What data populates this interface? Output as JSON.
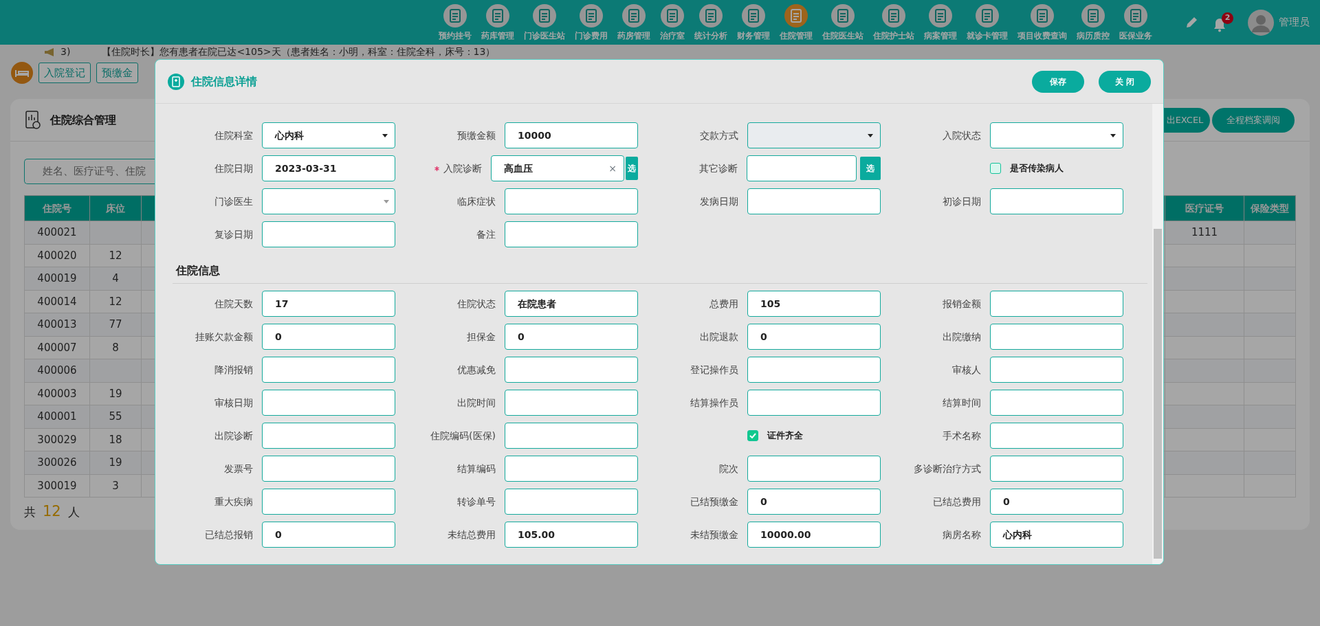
{
  "top_nav": {
    "items": [
      {
        "label": "预约挂号",
        "selected": false
      },
      {
        "label": "药库管理",
        "selected": false
      },
      {
        "label": "门诊医生站",
        "selected": false
      },
      {
        "label": "门诊费用",
        "selected": false
      },
      {
        "label": "药房管理",
        "selected": false
      },
      {
        "label": "治疗室",
        "selected": false
      },
      {
        "label": "统计分析",
        "selected": false
      },
      {
        "label": "财务管理",
        "selected": false
      },
      {
        "label": "住院管理",
        "selected": true
      },
      {
        "label": "住院医生站",
        "selected": false
      },
      {
        "label": "住院护士站",
        "selected": false
      },
      {
        "label": "病案管理",
        "selected": false
      },
      {
        "label": "就诊卡管理",
        "selected": false
      },
      {
        "label": "项目收费查询",
        "selected": false
      },
      {
        "label": "病历质控",
        "selected": false
      },
      {
        "label": "医保业务",
        "selected": false
      }
    ],
    "badge": "2",
    "user": "管理员"
  },
  "notice": {
    "prefix": "3)",
    "text": "【住院时长】您有患者在院已达<105>天（患者姓名：小明，科室：住院全科，床号：13）"
  },
  "toolbar": {
    "buttons": [
      "入院登记",
      "预缴金"
    ]
  },
  "panel": {
    "title": "住院综合管理",
    "buttons": [
      "出EXCEL",
      "全程档案调阅"
    ],
    "search": {
      "placeholder": "姓名、医疗证号、住院"
    },
    "table": {
      "columns": [
        "住院号",
        "床位",
        "医疗证号",
        "保险类型"
      ],
      "rows": [
        {
          "no": "400021",
          "insurance_no": "1111"
        },
        {
          "no": "400020",
          "bed": "12"
        },
        {
          "no": "400019",
          "bed": "4"
        },
        {
          "no": "400014",
          "bed": "12"
        },
        {
          "no": "400013",
          "bed": "77"
        },
        {
          "no": "400007",
          "bed": "8"
        },
        {
          "no": "400006"
        },
        {
          "no": "400003",
          "bed": "19"
        },
        {
          "no": "400001",
          "bed": "55"
        },
        {
          "no": "300029",
          "bed": "18"
        },
        {
          "no": "300026",
          "bed": "19"
        },
        {
          "no": "300019",
          "bed": "3"
        }
      ]
    },
    "footer": {
      "prefix": "共",
      "count": "12",
      "suffix": "人"
    }
  },
  "dialog": {
    "title": "住院信息详情",
    "buttons": [
      "保存",
      "关 闭"
    ],
    "sections": [
      {
        "fields": [
          {
            "label": "住院科室",
            "kind": "select",
            "value": "心内科"
          },
          {
            "label": "预缴金额",
            "kind": "text",
            "value": "10000"
          },
          {
            "label": "交款方式",
            "kind": "select",
            "disabled": true
          },
          {
            "label": "入院状态",
            "kind": "select"
          },
          {
            "label": "住院日期",
            "kind": "text",
            "value": "2023-03-31"
          },
          {
            "label": "入院诊断",
            "kind": "picker",
            "required": true,
            "value": "高血压",
            "clear": "×",
            "button": "选"
          },
          {
            "label": "其它诊断",
            "kind": "picker",
            "button": "选"
          },
          {
            "label": "是否传染病人",
            "kind": "checkbox",
            "checked": false
          },
          {
            "label": "门诊医生",
            "kind": "combo"
          },
          {
            "label": "临床症状",
            "kind": "text"
          },
          {
            "label": "发病日期",
            "kind": "text"
          },
          {
            "label": "初诊日期",
            "kind": "text"
          },
          {
            "label": "复诊日期",
            "kind": "text"
          },
          {
            "label": "备注",
            "kind": "text"
          }
        ]
      },
      {
        "title": "住院信息",
        "fields": [
          {
            "label": "住院天数",
            "kind": "text",
            "value": "17"
          },
          {
            "label": "住院状态",
            "kind": "text",
            "value": "在院患者"
          },
          {
            "label": "总费用",
            "kind": "text",
            "value": "105"
          },
          {
            "label": "报销金额",
            "kind": "text"
          },
          {
            "label": "挂账欠款金额",
            "kind": "text",
            "value": "0"
          },
          {
            "label": "担保金",
            "kind": "text",
            "value": "0"
          },
          {
            "label": "出院退款",
            "kind": "text",
            "value": "0"
          },
          {
            "label": "出院缴纳",
            "kind": "text"
          },
          {
            "label": "降消报销",
            "kind": "text"
          },
          {
            "label": "优惠减免",
            "kind": "text"
          },
          {
            "label": "登记操作员",
            "kind": "text"
          },
          {
            "label": "审核人",
            "kind": "text"
          },
          {
            "label": "审核日期",
            "kind": "text"
          },
          {
            "label": "出院时间",
            "kind": "text"
          },
          {
            "label": "结算操作员",
            "kind": "text"
          },
          {
            "label": "结算时间",
            "kind": "text"
          },
          {
            "label": "出院诊断",
            "kind": "text"
          },
          {
            "label": "住院编码(医保)",
            "kind": "text"
          },
          {
            "label": "证件齐全",
            "kind": "checkbox",
            "checked": true
          },
          {
            "label": "手术名称",
            "kind": "text"
          },
          {
            "label": "发票号",
            "kind": "text"
          },
          {
            "label": "结算编码",
            "kind": "text"
          },
          {
            "label": "院次",
            "kind": "text"
          },
          {
            "label": "多诊断治疗方式",
            "kind": "text"
          },
          {
            "label": "重大疾病",
            "kind": "text"
          },
          {
            "label": "转诊单号",
            "kind": "text"
          },
          {
            "label": "已结预缴金",
            "kind": "text",
            "value": "0"
          },
          {
            "label": "已结总费用",
            "kind": "text",
            "value": "0"
          },
          {
            "label": "已结总报销",
            "kind": "text",
            "value": "0"
          },
          {
            "label": "未结总费用",
            "kind": "text",
            "value": "105.00"
          },
          {
            "label": "未结预缴金",
            "kind": "text",
            "value": "10000.00"
          },
          {
            "label": "病房名称",
            "kind": "text",
            "value": "心内科"
          }
        ]
      }
    ]
  }
}
